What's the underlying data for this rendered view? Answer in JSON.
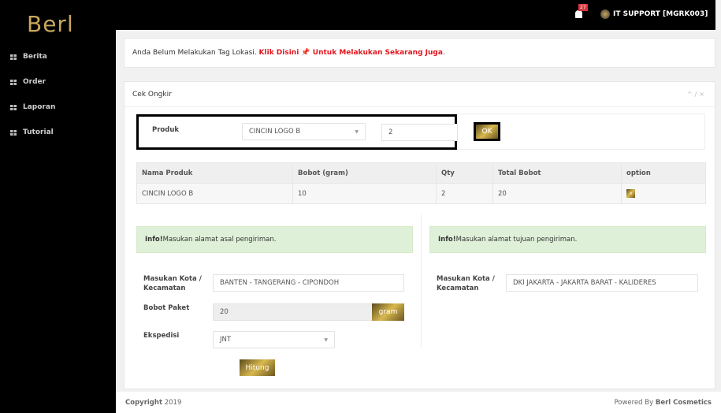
{
  "sidebar": {
    "logo": "Berl",
    "items": [
      {
        "label": "Berita"
      },
      {
        "label": "Order"
      },
      {
        "label": "Laporan"
      },
      {
        "label": "Tutorial"
      }
    ]
  },
  "topbar": {
    "notif_count": "27",
    "user": "IT SUPPORT [MGRK003]"
  },
  "alert": {
    "text": "Anda Belum Melakukan Tag Lokasi. ",
    "link": "Klik Disini 📌 Untuk Melakukan Sekarang Juga",
    "end": " ."
  },
  "panel": {
    "title": "Cek Ongkir",
    "tools": [
      "chevron-up-icon",
      "wrench-icon",
      "close-icon"
    ]
  },
  "product_form": {
    "label": "Produk",
    "product": "CINCIN LOGO B",
    "qty": "2",
    "ok": "OK"
  },
  "table": {
    "headers": [
      "Nama Produk",
      "Bobot (gram)",
      "Qty",
      "Total Bobot",
      "option"
    ],
    "rows": [
      [
        "CINCIN LOGO B",
        "10",
        "2",
        "20"
      ]
    ]
  },
  "origin": {
    "info_bold": "Info!",
    "info": " Masukan alamat asal pengiriman.",
    "city_label": "Masukan Kota / Kecamatan",
    "city": "BANTEN - TANGERANG - CIPONDOH",
    "weight_label": "Bobot Paket",
    "weight": "20",
    "unit": "gram",
    "courier_label": "Ekspedisi",
    "courier": "JNT",
    "submit": "Hitung"
  },
  "destination": {
    "info_bold": "Info!",
    "info": " Masukan alamat tujuan pengiriman.",
    "city_label": "Masukan Kota / Kecamatan",
    "city": "DKI JAKARTA - JAKARTA BARAT - KALIDERES"
  },
  "footer": {
    "copyright_bold": "Copyright",
    "year": " 2019",
    "powered": "Powered By ",
    "brand": "Berl Cosmetics"
  }
}
